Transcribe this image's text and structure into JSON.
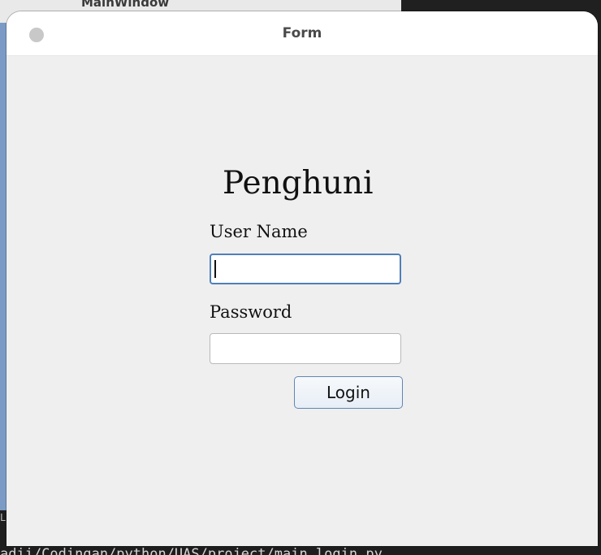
{
  "background_window": {
    "title": "MainWindow"
  },
  "form_window": {
    "title": "Form",
    "app_title": "Penghuni",
    "username_label": "User Name",
    "username_value": "",
    "password_label": "Password",
    "password_value": "",
    "login_button": "Login"
  },
  "terminal": {
    "left_mark": "L",
    "line": "adii/Codingan/python/UAS/project/main_login.py"
  },
  "colors": {
    "window_bg": "#efefef",
    "titlebar_bg": "#ffffff",
    "focus_border": "#4f7fb8",
    "button_border": "#5f86b3",
    "desktop_bg": "#202020"
  }
}
